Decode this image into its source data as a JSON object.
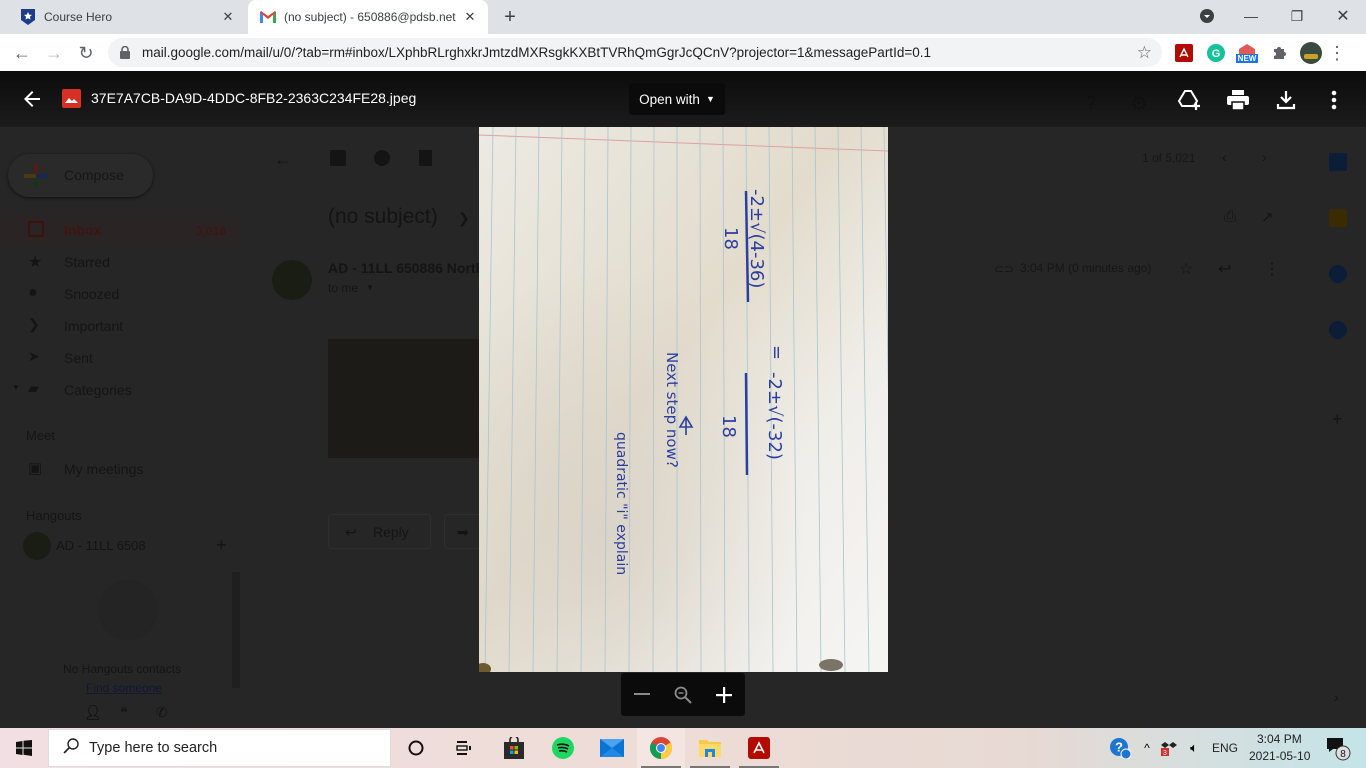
{
  "browser": {
    "tabs": [
      {
        "title": "Course Hero",
        "favicon": "course-hero-shield-icon",
        "active": false
      },
      {
        "title": "(no subject) - 650886@pdsb.net",
        "favicon": "gmail-icon",
        "active": true
      }
    ],
    "url": "mail.google.com/mail/u/0/?tab=rm#inbox/LXphbRLrghxkrJmtzdMXRsgkKXBtTVRhQmGgrJcQCnV?projector=1&messagePartId=0.1",
    "extensions": [
      "adobe-acrobat-icon",
      "grammarly-icon",
      "new-extension-icon",
      "puzzle-extensions-icon",
      "profile-avatar",
      "kebab-menu-icon"
    ],
    "new_badge": "NEW"
  },
  "gmail": {
    "compose_label": "Compose",
    "nav": [
      {
        "label": "Inbox",
        "count": "3,016",
        "icon": "inbox-icon"
      },
      {
        "label": "Starred",
        "icon": "star-icon"
      },
      {
        "label": "Snoozed",
        "icon": "clock-icon"
      },
      {
        "label": "Important",
        "icon": "important-icon"
      },
      {
        "label": "Sent",
        "icon": "send-icon"
      },
      {
        "label": "Categories",
        "icon": "label-icon"
      }
    ],
    "meet_heading": "Meet",
    "my_meetings": "My meetings",
    "hangouts_heading": "Hangouts",
    "hangouts_user": "AD - 11LL 6508",
    "no_contacts": "No Hangouts contacts",
    "find_someone": "Find someone",
    "subject": "(no subject)",
    "sender": "AD - 11LL 650886 North",
    "to_me": "to me",
    "time": "3:04 PM (0 minutes ago)",
    "pagination": "1 of 5,021",
    "reply_label": "Reply"
  },
  "viewer": {
    "file_name": "37E7A7CB-DA9D-4DDC-8FB2-2363C234FE28.jpeg",
    "open_with_label": "Open with",
    "image_content": {
      "line1_numerator": "-2±√(4-36)",
      "line1_denominator": "18",
      "equals": "=",
      "line2_numerator": "-2±√(-32)",
      "line2_denominator": "18",
      "note1": "Next step now?",
      "note2": "quadratic \"i\" explain"
    }
  },
  "taskbar": {
    "search_placeholder": "Type here to search",
    "language": "ENG",
    "time": "3:04 PM",
    "date": "2021-05-10",
    "notification_count": "8",
    "tray_badge": "3"
  }
}
